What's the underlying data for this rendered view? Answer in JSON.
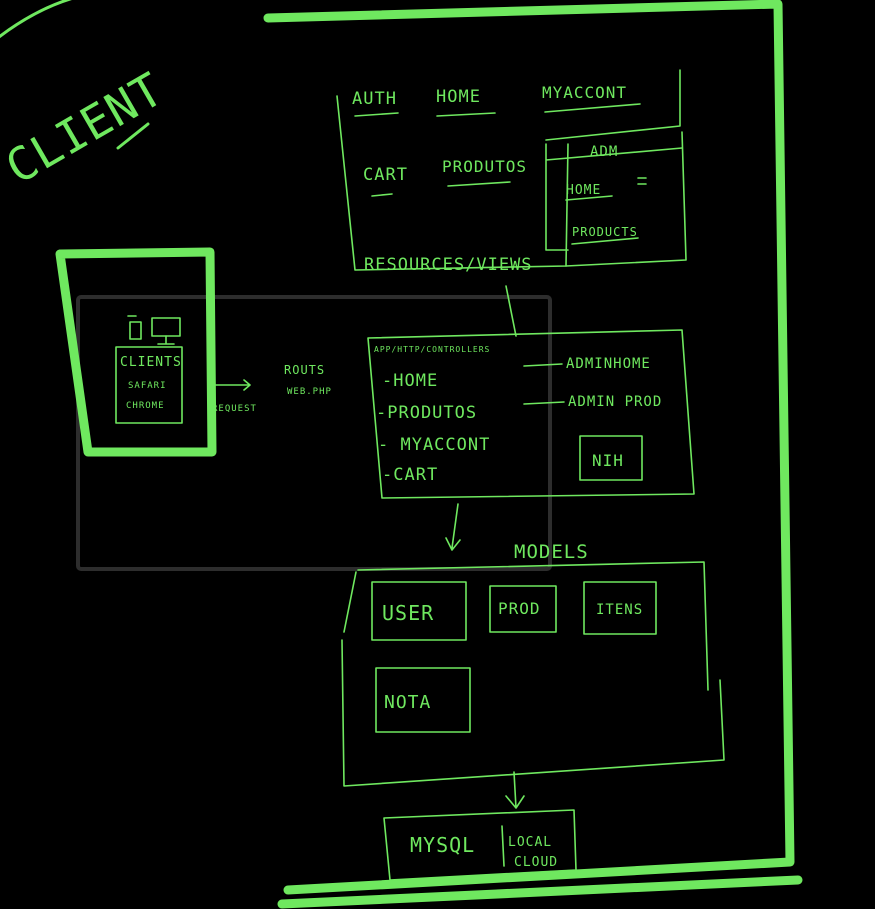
{
  "client_label": "CLIENT",
  "client_box": {
    "title": "CLIENTS",
    "browsers": [
      "SAFARI",
      "CHROME"
    ],
    "request_label": "REQUEST"
  },
  "routes_label": [
    "ROUTS",
    "WEB.PHP"
  ],
  "views": {
    "items_row1": [
      "AUTH",
      "HOME",
      "MYACCONT"
    ],
    "items_row2": [
      "CART",
      "PRODUTOS"
    ],
    "admin": {
      "title": "ADM",
      "items": [
        "HOME",
        "PRODUCTS"
      ]
    },
    "footer": "RESOURCES/VIEWS"
  },
  "controllers": {
    "path": "APP/HTTP/CONTROLLERS",
    "items": [
      "-HOME",
      "-PRODUTOS",
      "- MYACCONT",
      "-CART"
    ],
    "admin_items": [
      "ADMINHOME",
      "ADMIN PROD"
    ],
    "badge": "NIH"
  },
  "models": {
    "title": "MODELS",
    "items": [
      "USER",
      "PROD",
      "ITENS",
      "NOTA"
    ]
  },
  "database": {
    "name": "MYSQL",
    "modes": [
      "LOCAL",
      "CLOUD"
    ]
  },
  "colors": {
    "ink": "#6fe85f",
    "background": "#000000",
    "overlay_frame": "#2d2d2d"
  }
}
